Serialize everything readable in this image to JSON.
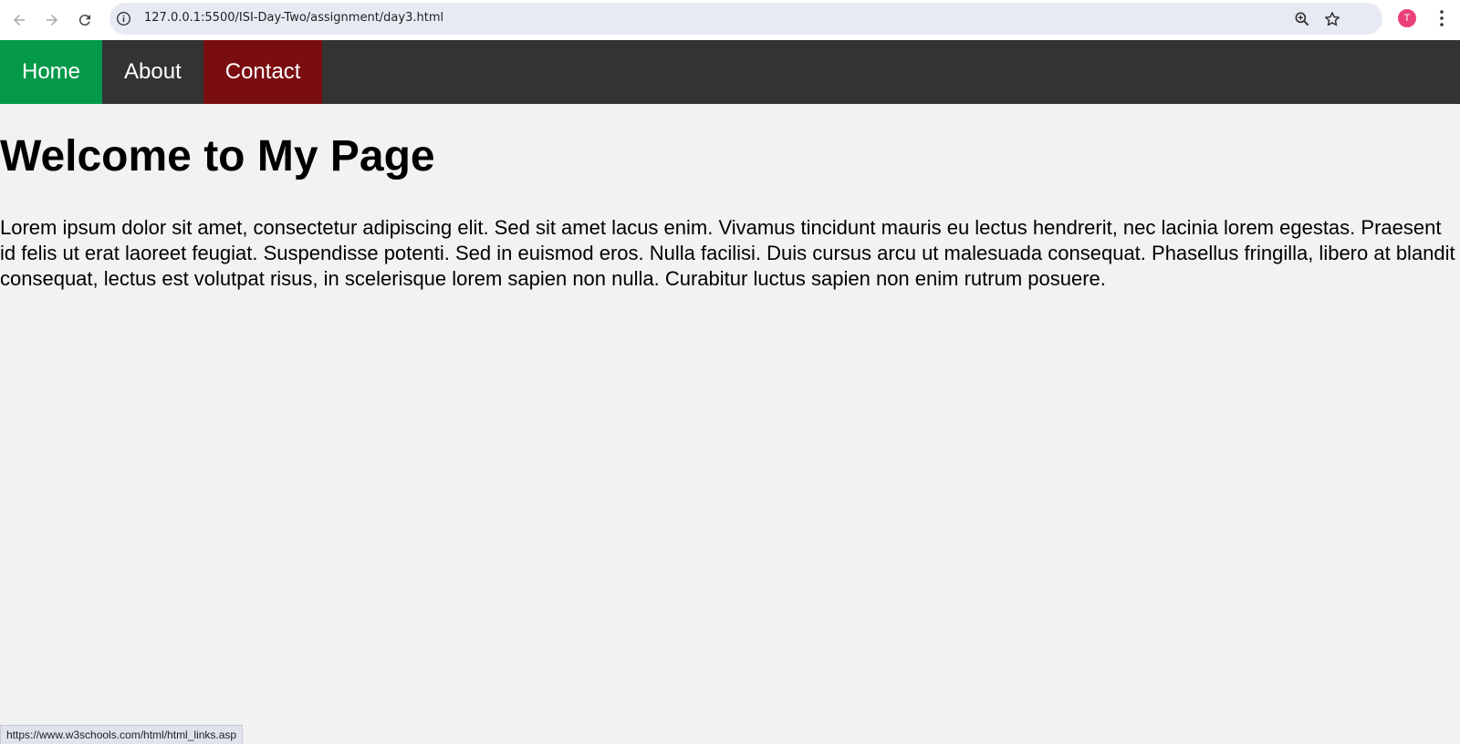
{
  "browser": {
    "url": "127.0.0.1:5500/ISI-Day-Two/assignment/day3.html",
    "profile_initial": "T",
    "status_link": "https://www.w3schools.com/html/html_links.asp"
  },
  "nav": {
    "items": [
      {
        "label": "Home",
        "color": "#04994a"
      },
      {
        "label": "About",
        "color": "#333333"
      },
      {
        "label": "Contact",
        "color": "#7a0d10"
      }
    ]
  },
  "page": {
    "heading": "Welcome to My Page",
    "paragraph": "Lorem ipsum dolor sit amet, consectetur adipiscing elit. Sed sit amet lacus enim. Vivamus tincidunt mauris eu lectus hendrerit, nec lacinia lorem egestas. Praesent id felis ut erat laoreet feugiat. Suspendisse potenti. Sed in euismod eros. Nulla facilisi. Duis cursus arcu ut malesuada consequat. Phasellus fringilla, libero at blandit consequat, lectus est volutpat risus, in scelerisque lorem sapien non nulla. Curabitur luctus sapien non enim rutrum posuere."
  },
  "icons": [
    "back-arrow-icon",
    "forward-arrow-icon",
    "reload-icon",
    "site-info-icon",
    "zoom-icon",
    "bookmark-star-icon",
    "more-menu-icon"
  ]
}
